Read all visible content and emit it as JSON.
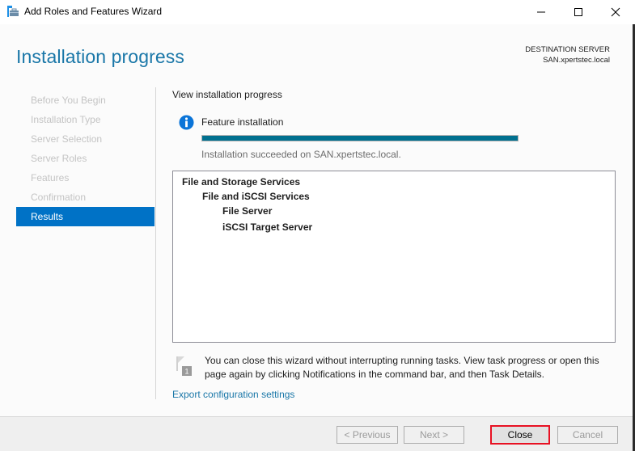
{
  "window": {
    "title": "Add Roles and Features Wizard",
    "controls": {
      "minimize": "minimize",
      "maximize": "maximize",
      "close": "close"
    }
  },
  "header": {
    "title": "Installation progress",
    "destination_label": "DESTINATION SERVER",
    "destination_server": "SAN.xpertstec.local"
  },
  "nav": {
    "items": [
      {
        "label": "Before You Begin",
        "active": false
      },
      {
        "label": "Installation Type",
        "active": false
      },
      {
        "label": "Server Selection",
        "active": false
      },
      {
        "label": "Server Roles",
        "active": false
      },
      {
        "label": "Features",
        "active": false
      },
      {
        "label": "Confirmation",
        "active": false
      },
      {
        "label": "Results",
        "active": true
      }
    ]
  },
  "main": {
    "section_label": "View installation progress",
    "feature_label": "Feature installation",
    "progress_percent": 100,
    "progress_color": "#00708f",
    "status_text": "Installation succeeded on SAN.xpertstec.local.",
    "results": [
      {
        "text": "File and Storage Services",
        "level": 0
      },
      {
        "text": "File and iSCSI Services",
        "level": 1
      },
      {
        "text": "File Server",
        "level": 2
      },
      {
        "text": "iSCSI Target Server",
        "level": 2
      }
    ],
    "notice_badge": "1",
    "notice_text": "You can close this wizard without interrupting running tasks. View task progress or open this page again by clicking Notifications in the command bar, and then Task Details.",
    "export_link": "Export configuration settings"
  },
  "footer": {
    "previous_label": "< Previous",
    "next_label": "Next >",
    "close_label": "Close",
    "cancel_label": "Cancel",
    "highlight_color": "#e81123"
  },
  "colors": {
    "accent": "#0072c6",
    "title": "#1a77a8"
  }
}
